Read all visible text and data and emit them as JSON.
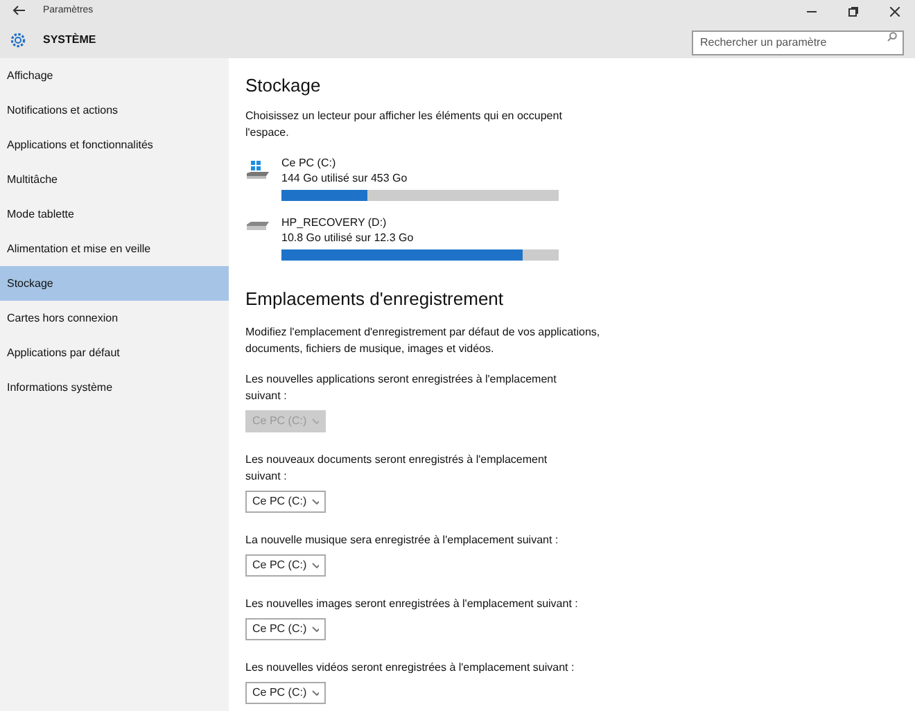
{
  "window": {
    "title": "Paramètres"
  },
  "header": {
    "title": "SYSTÈME",
    "search": {
      "placeholder": "Rechercher un paramètre"
    }
  },
  "sidebar": {
    "items": [
      {
        "label": "Affichage",
        "selected": false
      },
      {
        "label": "Notifications et actions",
        "selected": false
      },
      {
        "label": "Applications et fonctionnalités",
        "selected": false
      },
      {
        "label": "Multitâche",
        "selected": false
      },
      {
        "label": "Mode tablette",
        "selected": false
      },
      {
        "label": "Alimentation et mise en veille",
        "selected": false
      },
      {
        "label": "Stockage",
        "selected": true
      },
      {
        "label": "Cartes hors connexion",
        "selected": false
      },
      {
        "label": "Applications par défaut",
        "selected": false
      },
      {
        "label": "Informations système",
        "selected": false
      }
    ]
  },
  "storage": {
    "title": "Stockage",
    "description": "Choisissez un lecteur pour afficher les éléments qui en occupent l'espace.",
    "drives": [
      {
        "kind": "system",
        "name": "Ce PC (C:)",
        "usage": "144 Go utilisé sur 453 Go",
        "level": 0.31
      },
      {
        "kind": "plain",
        "name": "HP_RECOVERY (D:)",
        "usage": "10.8 Go utilisé sur 12.3 Go",
        "level": 0.87
      }
    ]
  },
  "save_locations": {
    "title": "Emplacements d'enregistrement",
    "description": "Modifiez l'emplacement d'enregistrement par défaut de vos applications, documents, fichiers de musique, images et vidéos.",
    "settings": [
      {
        "label": "Les nouvelles applications seront enregistrées à l'emplacement suivant :",
        "value": "Ce PC (C:)",
        "disabled": true
      },
      {
        "label": "Les nouveaux documents seront enregistrés à l'emplacement suivant :",
        "value": "Ce PC (C:)",
        "disabled": false
      },
      {
        "label": "La nouvelle musique sera enregistrée à l'emplacement suivant :",
        "value": "Ce PC (C:)",
        "disabled": false
      },
      {
        "label": "Les nouvelles images seront enregistrées à l'emplacement suivant :",
        "value": "Ce PC (C:)",
        "disabled": false
      },
      {
        "label": "Les nouvelles vidéos seront enregistrées à l'emplacement suivant :",
        "value": "Ce PC (C:)",
        "disabled": false
      }
    ]
  }
}
